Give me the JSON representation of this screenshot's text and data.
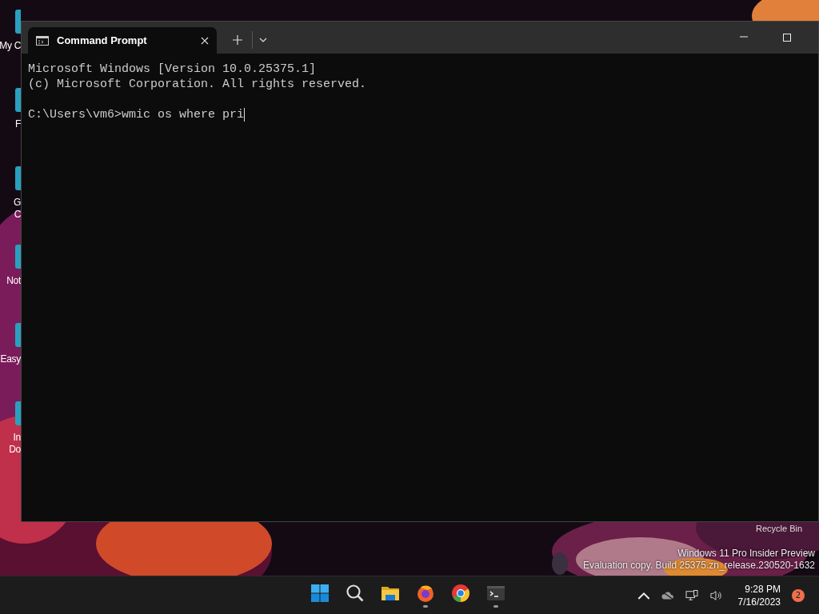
{
  "desktop": {
    "icons": [
      {
        "lines": [
          "My C"
        ]
      },
      {
        "lines": [
          "F"
        ]
      },
      {
        "lines": [
          "G",
          "C"
        ]
      },
      {
        "lines": [
          "Not"
        ]
      },
      {
        "lines": [
          "Easy"
        ]
      },
      {
        "lines": [
          "In",
          "Do"
        ]
      }
    ],
    "recycle_bin": {
      "label": "Recycle Bin"
    },
    "watermark": [
      "Windows 11 Pro Insider Preview",
      "Evaluation copy. Build 25375.zn_release.230520-1632"
    ]
  },
  "window": {
    "tab": {
      "title": "Command Prompt",
      "selected": true
    },
    "output": [
      "Microsoft Windows [Version 10.0.25375.1]",
      "(c) Microsoft Corporation. All rights reserved."
    ],
    "prompt": {
      "text": "C:\\Users\\vm6>wmic os where pri",
      "cursor": true
    }
  },
  "taskbar": {
    "apps": [
      {
        "kind": "start",
        "running": false
      },
      {
        "kind": "search",
        "running": false
      },
      {
        "kind": "files",
        "running": false
      },
      {
        "kind": "firefox",
        "running": true
      },
      {
        "kind": "chrome",
        "running": false
      },
      {
        "kind": "terminal",
        "running": true
      }
    ],
    "time": "9:28 PM",
    "date": "7/16/2023",
    "notifications": "2"
  }
}
